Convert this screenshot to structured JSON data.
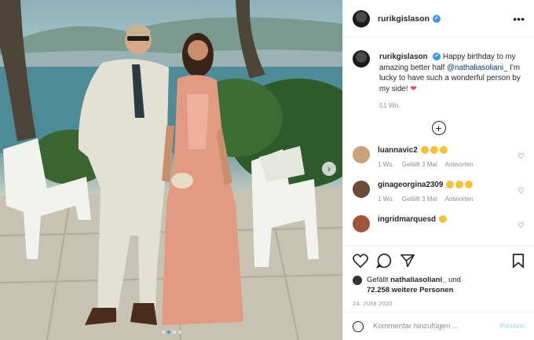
{
  "post": {
    "username": "rurikgislason",
    "verified": true,
    "more_label": "•••"
  },
  "caption": {
    "username": "rurikgislason",
    "text_before": "Happy birthday to my amazing better half ",
    "mention": "@nathaliasoliani_",
    "text_after": " I'm lucky to have such a wonderful person by my side! ",
    "heart": "❤",
    "age": "51 Wo."
  },
  "load_more_label": "+",
  "comments": [
    {
      "username": "luannavic2",
      "emojis": 3,
      "age": "1 Wo.",
      "likes": "Gefällt 3 Mal",
      "reply": "Antworten",
      "avatar_color": "#c9a27a"
    },
    {
      "username": "ginageorgina2309",
      "emojis": 3,
      "age": "1 Wo.",
      "likes": "Gefällt 3 Mal",
      "reply": "Antworten",
      "avatar_color": "#6b4a3a"
    },
    {
      "username": "ingridmarquesd",
      "emojis": 1,
      "age": "",
      "likes": "",
      "reply": "",
      "avatar_color": "#a0563c"
    }
  ],
  "likes": {
    "prefix": "Gefällt",
    "user": "nathaliasoliani_",
    "and": "und",
    "others": "72.258 weitere Personen"
  },
  "date": "24. JUNI 2020",
  "comment_box": {
    "placeholder": "Kommentar hinzufügen ...",
    "post_label": "Posten"
  },
  "colors": {
    "accent": "#3897f0",
    "heart": "#ed4956",
    "link": "#00376b",
    "post_disabled": "#b2dffc"
  },
  "carousel": {
    "count": 4,
    "active_index": 1
  },
  "icons": [
    "heart-icon",
    "comment-icon",
    "share-icon",
    "bookmark-icon",
    "emoji-icon",
    "chevron-right-icon",
    "verified-badge-icon",
    "more-icon"
  ]
}
